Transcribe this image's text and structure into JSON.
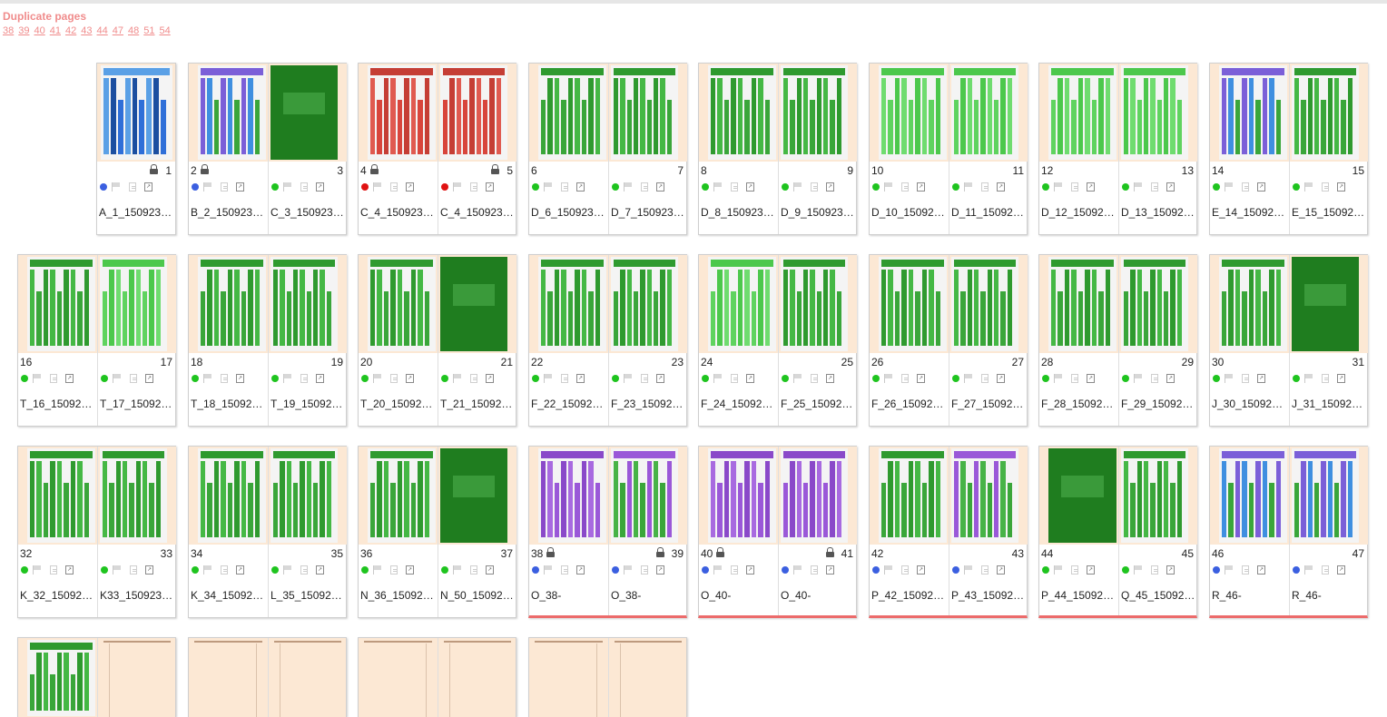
{
  "header": {
    "title": "Duplicate pages",
    "links": [
      "38",
      "39",
      "40",
      "41",
      "42",
      "43",
      "44",
      "47",
      "48",
      "51",
      "54"
    ]
  },
  "colors": {
    "link": "#f08c8c",
    "status_green": "#1fc41f",
    "status_blue": "#3b5fe0",
    "status_red": "#e01212",
    "warning_bar": "#ec6b6b",
    "page_bg": "#fce8d4",
    "layout_green": "#3aa63a",
    "layout_purple": "#9a58d8",
    "layout_red": "#d8453c"
  },
  "icons": [
    "lock-icon",
    "flag-icon",
    "note-icon",
    "pdf-icon"
  ],
  "spreads": [
    {
      "warn": false,
      "pages": [
        null,
        {
          "num": "1",
          "file": "A_1_150923…",
          "status": "blue",
          "locked": true,
          "theme": "blue"
        }
      ]
    },
    {
      "warn": false,
      "pages": [
        {
          "num": "2",
          "file": "B_2_150923…",
          "status": "blue",
          "locked": true,
          "theme": "mixed"
        },
        {
          "num": "3",
          "file": "C_3_150923…",
          "status": "green",
          "locked": false,
          "theme": "dark"
        }
      ]
    },
    {
      "warn": false,
      "pages": [
        {
          "num": "4",
          "file": "C_4_150923…",
          "status": "red",
          "locked": true,
          "theme": "red"
        },
        {
          "num": "5",
          "file": "C_4_150923…",
          "status": "red",
          "locked": true,
          "theme": "red"
        }
      ]
    },
    {
      "warn": false,
      "pages": [
        {
          "num": "6",
          "file": "D_6_150923…",
          "status": "green",
          "locked": false,
          "theme": "green"
        },
        {
          "num": "7",
          "file": "D_7_150923…",
          "status": "green",
          "locked": false,
          "theme": "green"
        }
      ]
    },
    {
      "warn": false,
      "pages": [
        {
          "num": "8",
          "file": "D_8_150923…",
          "status": "green",
          "locked": false,
          "theme": "green"
        },
        {
          "num": "9",
          "file": "D_9_150923…",
          "status": "green",
          "locked": false,
          "theme": "green"
        }
      ]
    },
    {
      "warn": false,
      "pages": [
        {
          "num": "10",
          "file": "D_10_15092…",
          "status": "green",
          "locked": false,
          "theme": "light"
        },
        {
          "num": "11",
          "file": "D_11_15092…",
          "status": "green",
          "locked": false,
          "theme": "light"
        }
      ]
    },
    {
      "warn": false,
      "pages": [
        {
          "num": "12",
          "file": "D_12_15092…",
          "status": "green",
          "locked": false,
          "theme": "light"
        },
        {
          "num": "13",
          "file": "D_13_15092…",
          "status": "green",
          "locked": false,
          "theme": "light"
        }
      ]
    },
    {
      "warn": false,
      "pages": [
        {
          "num": "14",
          "file": "E_14_15092…",
          "status": "green",
          "locked": false,
          "theme": "mixed"
        },
        {
          "num": "15",
          "file": "E_15_15092…",
          "status": "green",
          "locked": false,
          "theme": "green"
        }
      ]
    },
    {
      "warn": false,
      "pages": [
        {
          "num": "16",
          "file": "T_16_15092…",
          "status": "green",
          "locked": false,
          "theme": "green"
        },
        {
          "num": "17",
          "file": "T_17_15092…",
          "status": "green",
          "locked": false,
          "theme": "light"
        }
      ]
    },
    {
      "warn": false,
      "pages": [
        {
          "num": "18",
          "file": "T_18_15092…",
          "status": "green",
          "locked": false,
          "theme": "green"
        },
        {
          "num": "19",
          "file": "T_19_15092…",
          "status": "green",
          "locked": false,
          "theme": "green"
        }
      ]
    },
    {
      "warn": false,
      "pages": [
        {
          "num": "20",
          "file": "T_20_15092…",
          "status": "green",
          "locked": false,
          "theme": "green"
        },
        {
          "num": "21",
          "file": "T_21_15092…",
          "status": "green",
          "locked": false,
          "theme": "dark"
        }
      ]
    },
    {
      "warn": false,
      "pages": [
        {
          "num": "22",
          "file": "F_22_15092…",
          "status": "green",
          "locked": false,
          "theme": "green"
        },
        {
          "num": "23",
          "file": "F_23_15092…",
          "status": "green",
          "locked": false,
          "theme": "green"
        }
      ]
    },
    {
      "warn": false,
      "pages": [
        {
          "num": "24",
          "file": "F_24_15092…",
          "status": "green",
          "locked": false,
          "theme": "light"
        },
        {
          "num": "25",
          "file": "F_25_15092…",
          "status": "green",
          "locked": false,
          "theme": "green"
        }
      ]
    },
    {
      "warn": false,
      "pages": [
        {
          "num": "26",
          "file": "F_26_15092…",
          "status": "green",
          "locked": false,
          "theme": "green"
        },
        {
          "num": "27",
          "file": "F_27_15092…",
          "status": "green",
          "locked": false,
          "theme": "green"
        }
      ]
    },
    {
      "warn": false,
      "pages": [
        {
          "num": "28",
          "file": "F_28_15092…",
          "status": "green",
          "locked": false,
          "theme": "green"
        },
        {
          "num": "29",
          "file": "F_29_15092…",
          "status": "green",
          "locked": false,
          "theme": "green"
        }
      ]
    },
    {
      "warn": false,
      "pages": [
        {
          "num": "30",
          "file": "J_30_15092…",
          "status": "green",
          "locked": false,
          "theme": "green"
        },
        {
          "num": "31",
          "file": "J_31_15092…",
          "status": "green",
          "locked": false,
          "theme": "dark"
        }
      ]
    },
    {
      "warn": false,
      "pages": [
        {
          "num": "32",
          "file": "K_32_15092…",
          "status": "green",
          "locked": false,
          "theme": "green"
        },
        {
          "num": "33",
          "file": "K33_150923…",
          "status": "green",
          "locked": false,
          "theme": "green"
        }
      ]
    },
    {
      "warn": false,
      "pages": [
        {
          "num": "34",
          "file": "K_34_15092…",
          "status": "green",
          "locked": false,
          "theme": "green"
        },
        {
          "num": "35",
          "file": "L_35_15092…",
          "status": "green",
          "locked": false,
          "theme": "green"
        }
      ]
    },
    {
      "warn": false,
      "pages": [
        {
          "num": "36",
          "file": "N_36_15092…",
          "status": "green",
          "locked": false,
          "theme": "green"
        },
        {
          "num": "37",
          "file": "N_50_15092…",
          "status": "green",
          "locked": false,
          "theme": "dark"
        }
      ]
    },
    {
      "warn": true,
      "pages": [
        {
          "num": "38",
          "file": "O_38-",
          "status": "blue",
          "locked": true,
          "theme": "purple"
        },
        {
          "num": "39",
          "file": "O_38-",
          "status": "blue",
          "locked": true,
          "theme": "mixedp"
        }
      ]
    },
    {
      "warn": true,
      "pages": [
        {
          "num": "40",
          "file": "O_40-",
          "status": "blue",
          "locked": true,
          "theme": "purple"
        },
        {
          "num": "41",
          "file": "O_40-",
          "status": "blue",
          "locked": true,
          "theme": "purple"
        }
      ]
    },
    {
      "warn": true,
      "pages": [
        {
          "num": "42",
          "file": "P_42_15092…",
          "status": "blue",
          "locked": false,
          "theme": "green"
        },
        {
          "num": "43",
          "file": "P_43_15092…",
          "status": "blue",
          "locked": false,
          "theme": "mixedp"
        }
      ]
    },
    {
      "warn": true,
      "pages": [
        {
          "num": "44",
          "file": "P_44_15092…",
          "status": "green",
          "locked": false,
          "theme": "dark"
        },
        {
          "num": "45",
          "file": "Q_45_15092…",
          "status": "green",
          "locked": false,
          "theme": "green"
        }
      ]
    },
    {
      "warn": true,
      "pages": [
        {
          "num": "46",
          "file": "R_46-",
          "status": "blue",
          "locked": false,
          "theme": "mixed"
        },
        {
          "num": "47",
          "file": "R_46-",
          "status": "blue",
          "locked": false,
          "theme": "mixed"
        }
      ]
    },
    {
      "warn": false,
      "empty": true,
      "pages": [
        {
          "theme": "green"
        },
        {
          "theme": "blank"
        }
      ]
    },
    {
      "warn": false,
      "empty": true,
      "pages": [
        {
          "theme": "blank"
        },
        {
          "theme": "blank"
        }
      ]
    },
    {
      "warn": false,
      "empty": true,
      "pages": [
        {
          "theme": "blank"
        },
        {
          "theme": "blank"
        }
      ]
    },
    {
      "warn": false,
      "empty": true,
      "pages": [
        {
          "theme": "blank"
        },
        {
          "theme": "blank"
        }
      ]
    }
  ]
}
